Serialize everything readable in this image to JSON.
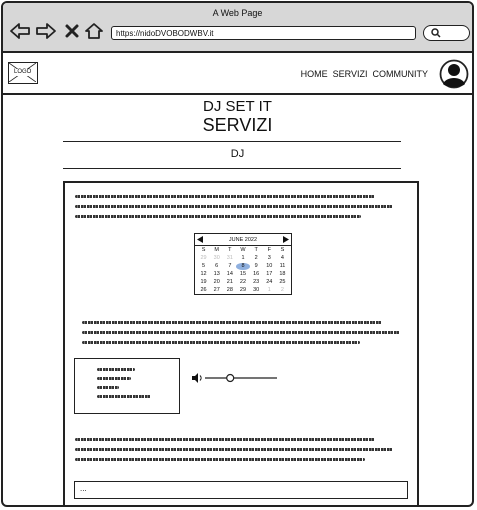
{
  "browser": {
    "window_title": "A Web Page",
    "url": "https://nidoDVOBODWBV.it",
    "icons": [
      "back-arrow-icon",
      "forward-arrow-icon",
      "close-x-icon",
      "home-icon",
      "search-icon"
    ]
  },
  "site": {
    "logo_text": "LOGO",
    "nav": [
      "HOME",
      "SERVIZI",
      "COMMUNITY"
    ],
    "title": "DJ SET IT",
    "subtitle": "SERVIZI",
    "section": "DJ"
  },
  "calendar": {
    "month": "JUNE 2022",
    "weekdays": [
      "S",
      "M",
      "T",
      "W",
      "T",
      "F",
      "S"
    ],
    "weeks": [
      [
        {
          "d": "29",
          "dim": true
        },
        {
          "d": "30",
          "dim": true
        },
        {
          "d": "31",
          "dim": true
        },
        {
          "d": "1"
        },
        {
          "d": "2"
        },
        {
          "d": "3"
        },
        {
          "d": "4"
        }
      ],
      [
        {
          "d": "5"
        },
        {
          "d": "6"
        },
        {
          "d": "7"
        },
        {
          "d": "8",
          "sel": true
        },
        {
          "d": "9"
        },
        {
          "d": "10"
        },
        {
          "d": "11"
        }
      ],
      [
        {
          "d": "12"
        },
        {
          "d": "13"
        },
        {
          "d": "14"
        },
        {
          "d": "15"
        },
        {
          "d": "16"
        },
        {
          "d": "17"
        },
        {
          "d": "18"
        }
      ],
      [
        {
          "d": "19"
        },
        {
          "d": "20"
        },
        {
          "d": "21"
        },
        {
          "d": "22"
        },
        {
          "d": "23"
        },
        {
          "d": "24"
        },
        {
          "d": "25"
        }
      ],
      [
        {
          "d": "26"
        },
        {
          "d": "27"
        },
        {
          "d": "28"
        },
        {
          "d": "29"
        },
        {
          "d": "30"
        },
        {
          "d": "1",
          "dim": true
        },
        {
          "d": "2",
          "dim": true
        }
      ]
    ]
  },
  "audio": {
    "progress": 0.35
  },
  "input": {
    "value": "..."
  }
}
